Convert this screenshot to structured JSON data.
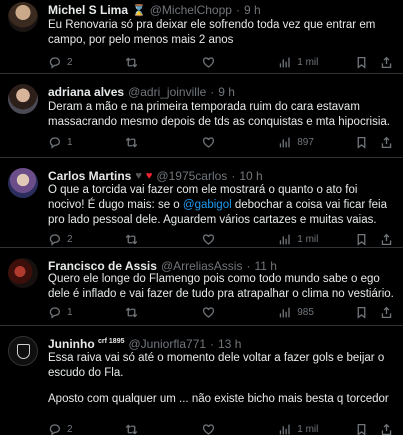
{
  "tweets": [
    {
      "name": "Michel S Lima",
      "handle": "@MichelChopp",
      "time": "9 h",
      "text": "Eu Renovaria só pra deixar ele sofrendo toda vez que entrar em campo, por pelo menos mais 2 anos",
      "replies": "2",
      "retweets": "",
      "likes": "",
      "views": "1 mil"
    },
    {
      "name": "adriana alves",
      "handle": "@adri_joinville",
      "time": "9 h",
      "text": "Deram a mão e na primeira temporada ruim do cara estavam massacrando mesmo depois de tds as conquistas e mta hipocrisia.",
      "replies": "1",
      "retweets": "",
      "likes": "",
      "views": "897"
    },
    {
      "name": "Carlos Martins",
      "handle": "@1975carlos",
      "time": "10 h",
      "text_before": "O que a torcida vai fazer com ele mostrará o quanto o ato foi nocivo! É dugo mais: se o ",
      "mention": "@gabigol",
      "text_after": " debochar a coisa vai ficar feia pro lado pessoal dele. Aguardem vários cartazes e muitas vaias.",
      "replies": "2",
      "retweets": "",
      "likes": "",
      "views": "1 mil"
    },
    {
      "name": "Francisco de Assis",
      "handle": "@ArreliasAssis",
      "time": "11 h",
      "text": "Quero ele longe do Flamengo pois como todo mundo sabe o ego dele é inflado e vai fazer de tudo pra atrapalhar o clima no vestiário.",
      "replies": "1",
      "retweets": "",
      "likes": "",
      "views": "985"
    },
    {
      "name": "Juninho",
      "name_sup": "crf 1895",
      "handle": "@Juniorfla771",
      "time": "13 h",
      "text": "Essa raiva vai só até o momento dele voltar a fazer gols e beijar o escudo do Fla.",
      "text2": "Aposto com qualquer um ... não existe bicho mais besta q torcedor",
      "replies": "2",
      "retweets": "",
      "likes": "",
      "views": "1 mil"
    }
  ],
  "common": {
    "dot": "·"
  }
}
